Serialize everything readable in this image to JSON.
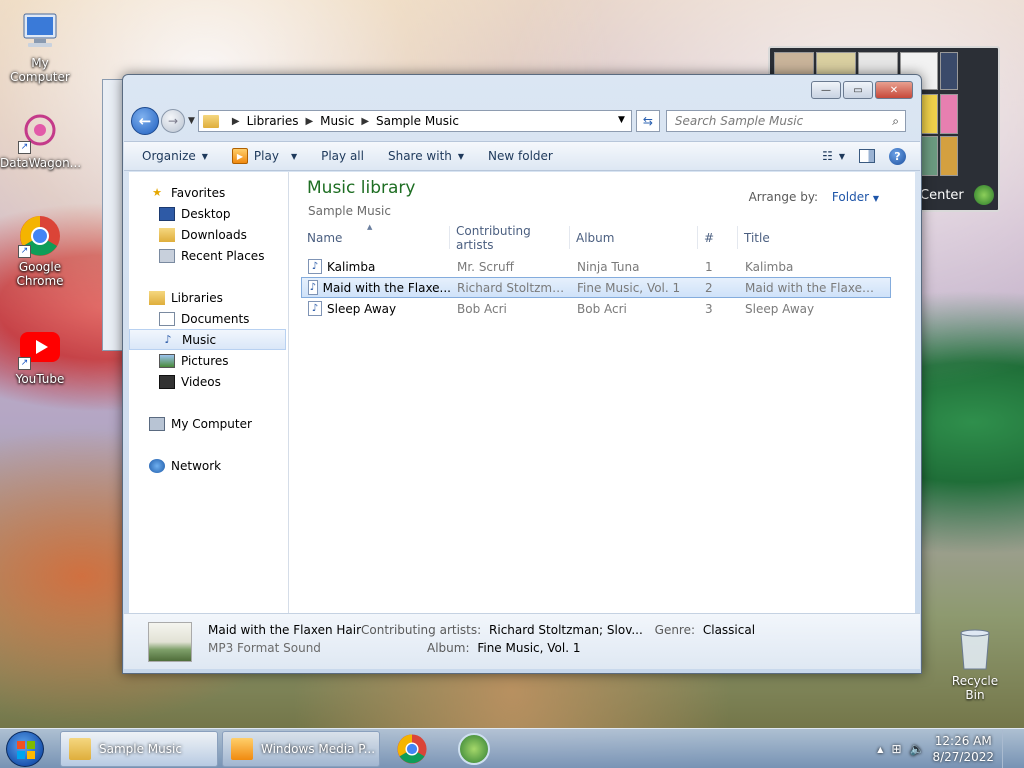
{
  "desktop": {
    "icons": [
      {
        "label": "My Computer"
      },
      {
        "label": "DataWagon..."
      },
      {
        "label": "Google Chrome"
      },
      {
        "label": "YouTube"
      },
      {
        "label": "Recycle Bin"
      }
    ],
    "gadget_text": "Center"
  },
  "window": {
    "controls": {
      "minimize": "—",
      "maximize": "▭",
      "close": "✕"
    },
    "breadcrumb": [
      "Libraries",
      "Music",
      "Sample Music"
    ],
    "search_placeholder": "Search Sample Music",
    "toolbar": {
      "organize": "Organize",
      "play": "Play",
      "play_all": "Play all",
      "share_with": "Share with",
      "new_folder": "New folder"
    },
    "nav": {
      "favorites": "Favorites",
      "desktop": "Desktop",
      "downloads": "Downloads",
      "recent_places": "Recent Places",
      "libraries": "Libraries",
      "documents": "Documents",
      "music": "Music",
      "pictures": "Pictures",
      "videos": "Videos",
      "my_computer": "My Computer",
      "network": "Network"
    },
    "library": {
      "title": "Music library",
      "subtitle": "Sample Music",
      "arrange_label": "Arrange by:",
      "arrange_value": "Folder"
    },
    "columns": [
      "Name",
      "Contributing artists",
      "Album",
      "#",
      "Title"
    ],
    "rows": [
      {
        "name": "Kalimba",
        "artist": "Mr. Scruff",
        "album": "Ninja Tuna",
        "num": "1",
        "title": "Kalimba"
      },
      {
        "name": "Maid with the Flaxe...",
        "artist": "Richard Stoltzman...",
        "album": "Fine Music, Vol. 1",
        "num": "2",
        "title": "Maid with the Flaxen H..."
      },
      {
        "name": "Sleep Away",
        "artist": "Bob Acri",
        "album": "Bob Acri",
        "num": "3",
        "title": "Sleep Away"
      }
    ],
    "details": {
      "title": "Maid with the Flaxen Hair",
      "format": "MP3 Format Sound",
      "artists_label": "Contributing artists:",
      "artists_value": "Richard Stoltzman; Slov...",
      "genre_label": "Genre:",
      "genre_value": "Classical",
      "album_label": "Album:",
      "album_value": "Fine Music, Vol. 1"
    }
  },
  "taskbar": {
    "tasks": [
      "Sample Music",
      "Windows Media P..."
    ],
    "time": "12:26 AM",
    "date": "8/27/2022"
  },
  "colors": {
    "library_title": "#1e6e23",
    "selection": "#cfe2f9",
    "link_blue": "#1e55a8"
  }
}
